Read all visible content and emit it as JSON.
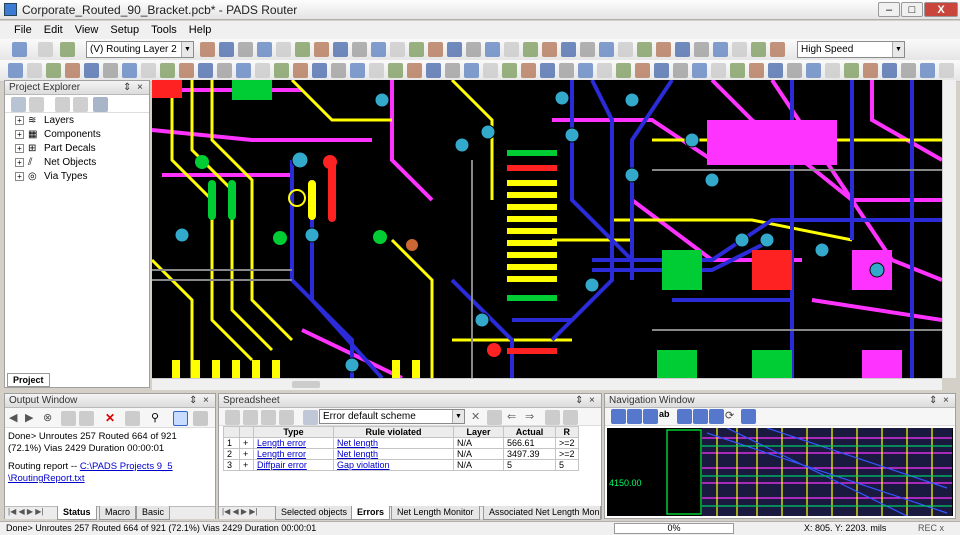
{
  "window": {
    "title": "Corporate_Routed_90_Bracket.pcb* - PADS Router",
    "minimize": "–",
    "maximize": "□",
    "close": "X"
  },
  "menu": [
    "File",
    "Edit",
    "View",
    "Setup",
    "Tools",
    "Help"
  ],
  "toolbar": {
    "layer_combo": "(V) Routing Layer 2",
    "speed_combo": "High Speed"
  },
  "project_explorer": {
    "title": "Project Explorer",
    "pin": "⇕",
    "close": "×",
    "items": [
      {
        "label": "Layers",
        "icon": "layers-icon"
      },
      {
        "label": "Components",
        "icon": "components-icon"
      },
      {
        "label": "Part Decals",
        "icon": "part-decals-icon"
      },
      {
        "label": "Net Objects",
        "icon": "net-objects-icon"
      },
      {
        "label": "Via Types",
        "icon": "via-types-icon"
      }
    ],
    "tab": "Project"
  },
  "output_window": {
    "title": "Output Window",
    "line1": "Done> Unroutes 257 Routed 664 of 921",
    "line2": "(72.1%) Vias 2429 Duration 00:00:01",
    "report_prefix": "Routing report -- ",
    "report_link1": "C:\\PADS Projects 9_5",
    "report_link2": "\\RoutingReport.txt",
    "tabs": [
      "Status",
      "Macro",
      "Basic"
    ]
  },
  "spreadsheet": {
    "title": "Spreadsheet",
    "scheme": "Error default scheme",
    "columns": [
      "Type",
      "Rule violated",
      "Layer",
      "Actual",
      "R"
    ],
    "rows": [
      {
        "num": "1",
        "type": "Length error",
        "rule": "Net length",
        "layer": "N/A",
        "actual": "566.61",
        "r": ">=2"
      },
      {
        "num": "2",
        "type": "Length error",
        "rule": "Net length",
        "layer": "N/A",
        "actual": "3497.39",
        "r": ">=2"
      },
      {
        "num": "3",
        "type": "Diffpair error",
        "rule": "Gap violation",
        "layer": "N/A",
        "actual": "5",
        "r": "5"
      }
    ],
    "tabs": [
      "Selected objects",
      "Errors",
      "Net Length Monitor",
      "Associated Net Length Monito"
    ]
  },
  "navigation": {
    "title": "Navigation Window",
    "coord_label": "4150.00"
  },
  "status": {
    "text": "Done> Unroutes 257  Routed 664 of 921 (72.1%)  Vias 2429  Duration 00:00:01",
    "progress": "0%",
    "coords": "X: 805.  Y: 2203.  mils",
    "rec": "REC  x"
  },
  "colors": {
    "board_bg": "#000000",
    "yellow": "#ffff00",
    "blue": "#2b2bd8",
    "magenta": "#ff33ff",
    "cyan": "#33aacc",
    "green": "#00cc33",
    "red": "#ff2222"
  }
}
